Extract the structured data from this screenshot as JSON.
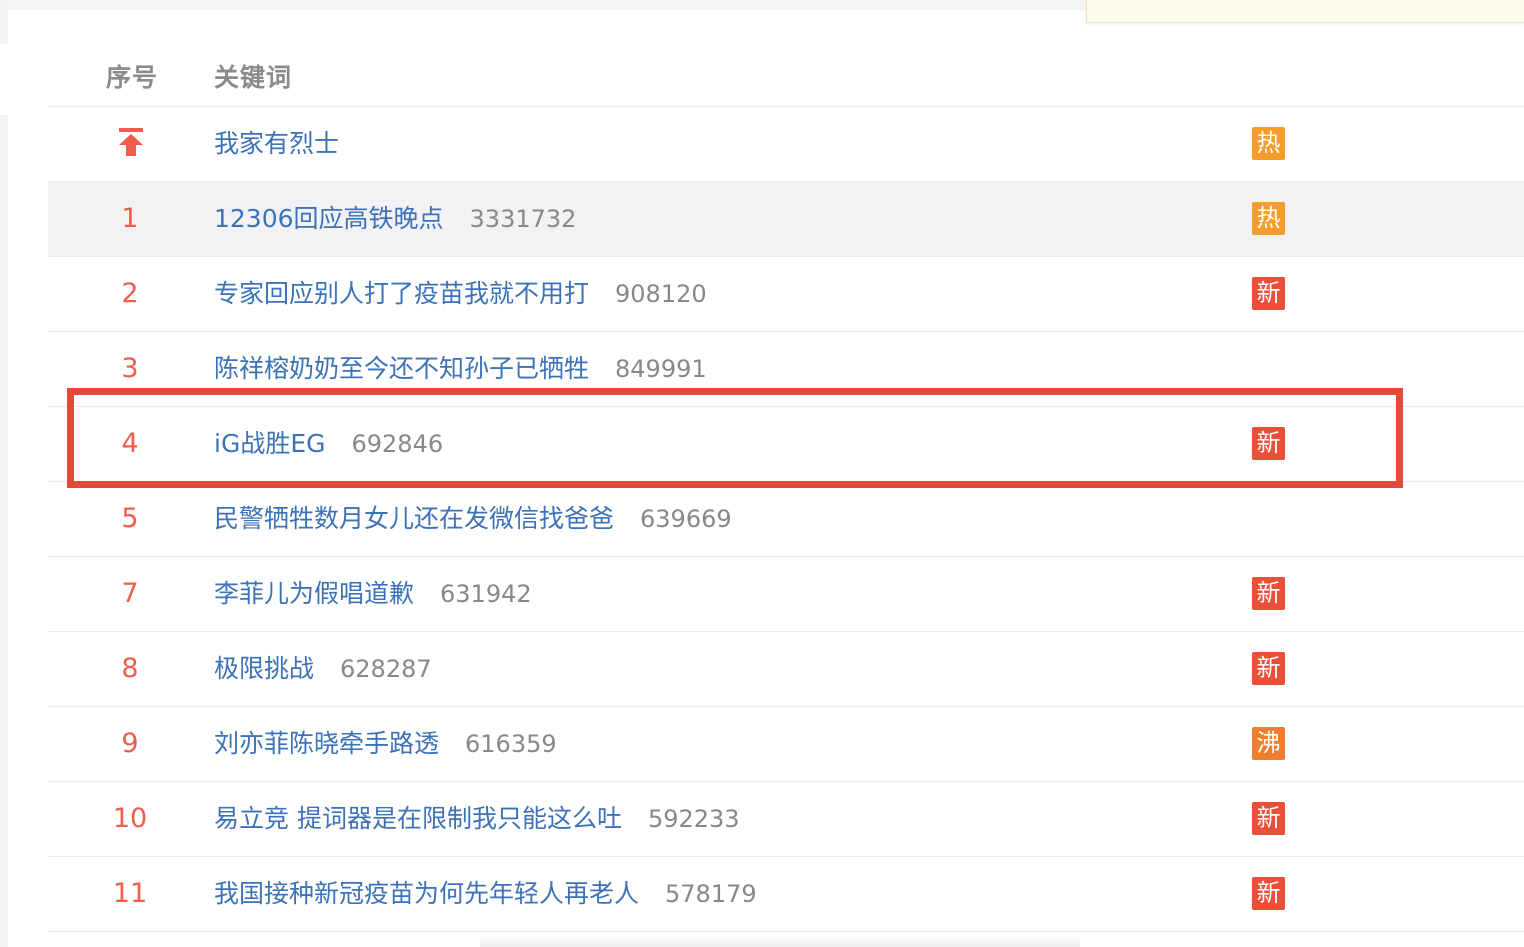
{
  "colors": {
    "rank": "#ef5e4a",
    "link": "#3c73b8",
    "count": "#888888",
    "badge_hot": "#f59d2a",
    "badge_new": "#e8503a",
    "badge_boil": "#ef7f2e",
    "annotation": "#e34a3c",
    "highlight_row": "#f2f2f4"
  },
  "header": {
    "rank_label": "序号",
    "keyword_label": "关键词"
  },
  "rows": [
    {
      "rank": "",
      "pinned": true,
      "keyword": "我家有烈士",
      "count": "",
      "badge": "热",
      "badge_type": "hot",
      "highlighted": false
    },
    {
      "rank": "1",
      "pinned": false,
      "keyword": "12306回应高铁晚点",
      "count": "3331732",
      "badge": "热",
      "badge_type": "hot",
      "highlighted": true
    },
    {
      "rank": "2",
      "pinned": false,
      "keyword": "专家回应别人打了疫苗我就不用打",
      "count": "908120",
      "badge": "新",
      "badge_type": "new",
      "highlighted": false
    },
    {
      "rank": "3",
      "pinned": false,
      "keyword": "陈祥榕奶奶至今还不知孙子已牺牲",
      "count": "849991",
      "badge": "",
      "badge_type": "",
      "highlighted": false
    },
    {
      "rank": "4",
      "pinned": false,
      "keyword": "iG战胜EG",
      "count": "692846",
      "badge": "新",
      "badge_type": "new",
      "highlighted": false
    },
    {
      "rank": "5",
      "pinned": false,
      "keyword": "民警牺牲数月女儿还在发微信找爸爸",
      "count": "639669",
      "badge": "",
      "badge_type": "",
      "highlighted": false
    },
    {
      "rank": "7",
      "pinned": false,
      "keyword": "李菲儿为假唱道歉",
      "count": "631942",
      "badge": "新",
      "badge_type": "new",
      "highlighted": false
    },
    {
      "rank": "8",
      "pinned": false,
      "keyword": "极限挑战",
      "count": "628287",
      "badge": "新",
      "badge_type": "new",
      "highlighted": false
    },
    {
      "rank": "9",
      "pinned": false,
      "keyword": "刘亦菲陈晓牵手路透",
      "count": "616359",
      "badge": "沸",
      "badge_type": "boil",
      "highlighted": false
    },
    {
      "rank": "10",
      "pinned": false,
      "keyword": "易立竞 提词器是在限制我只能这么吐",
      "count": "592233",
      "badge": "新",
      "badge_type": "new",
      "highlighted": false
    },
    {
      "rank": "11",
      "pinned": false,
      "keyword": "我国接种新冠疫苗为何先年轻人再老人",
      "count": "578179",
      "badge": "新",
      "badge_type": "new",
      "highlighted": false
    }
  ],
  "annotation": {
    "highlighted_rank": "4"
  }
}
